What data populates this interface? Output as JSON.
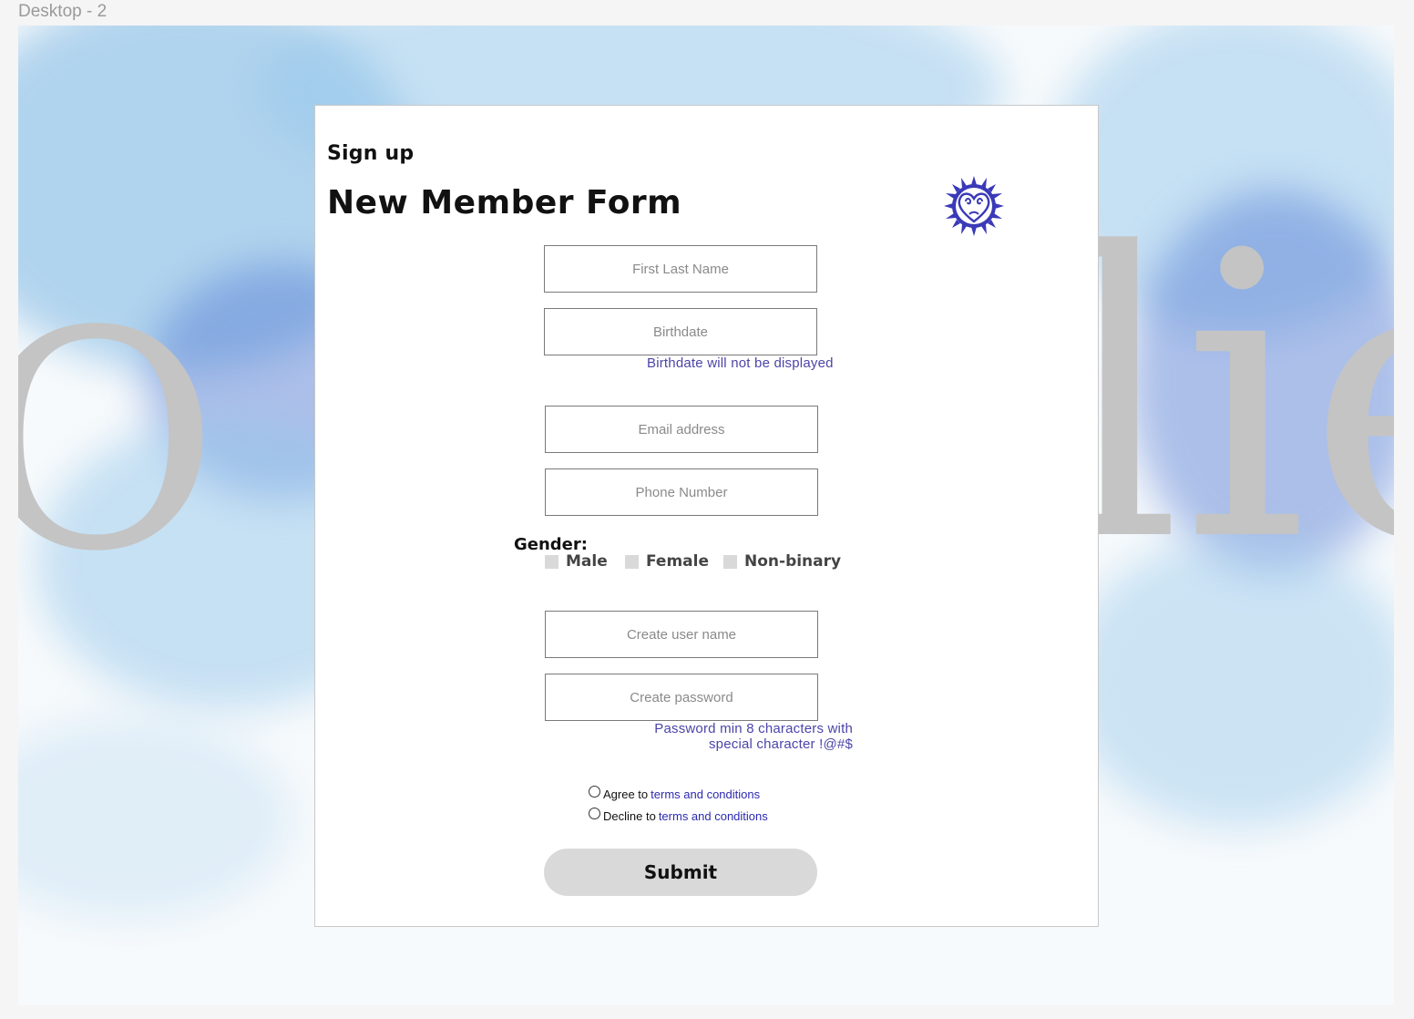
{
  "frame": {
    "label": "Desktop - 2"
  },
  "background": {
    "word_left": "O",
    "word_right": "lie"
  },
  "form": {
    "eyebrow": "Sign up",
    "title": "New Member Form",
    "fields": {
      "name_placeholder": "First Last Name",
      "birthdate_placeholder": "Birthdate",
      "birthdate_hint": "Birthdate will not be displayed",
      "email_placeholder": "Email address",
      "phone_placeholder": "Phone Number",
      "username_placeholder": "Create user name",
      "password_placeholder": "Create password",
      "password_hint_line1": "Password min 8 characters with",
      "password_hint_line2": "special character !@#$"
    },
    "gender": {
      "label": "Gender:",
      "options": [
        "Male",
        "Female",
        "Non-binary"
      ]
    },
    "terms": {
      "agree_prefix": "Agree to",
      "decline_prefix": "Decline to",
      "link_text": "terms and conditions"
    },
    "submit_label": "Submit"
  },
  "colors": {
    "hint": "#4b45a8",
    "link": "#2c2ab0",
    "emblem": "#3a3ab8",
    "button": "#d9d9d9"
  }
}
